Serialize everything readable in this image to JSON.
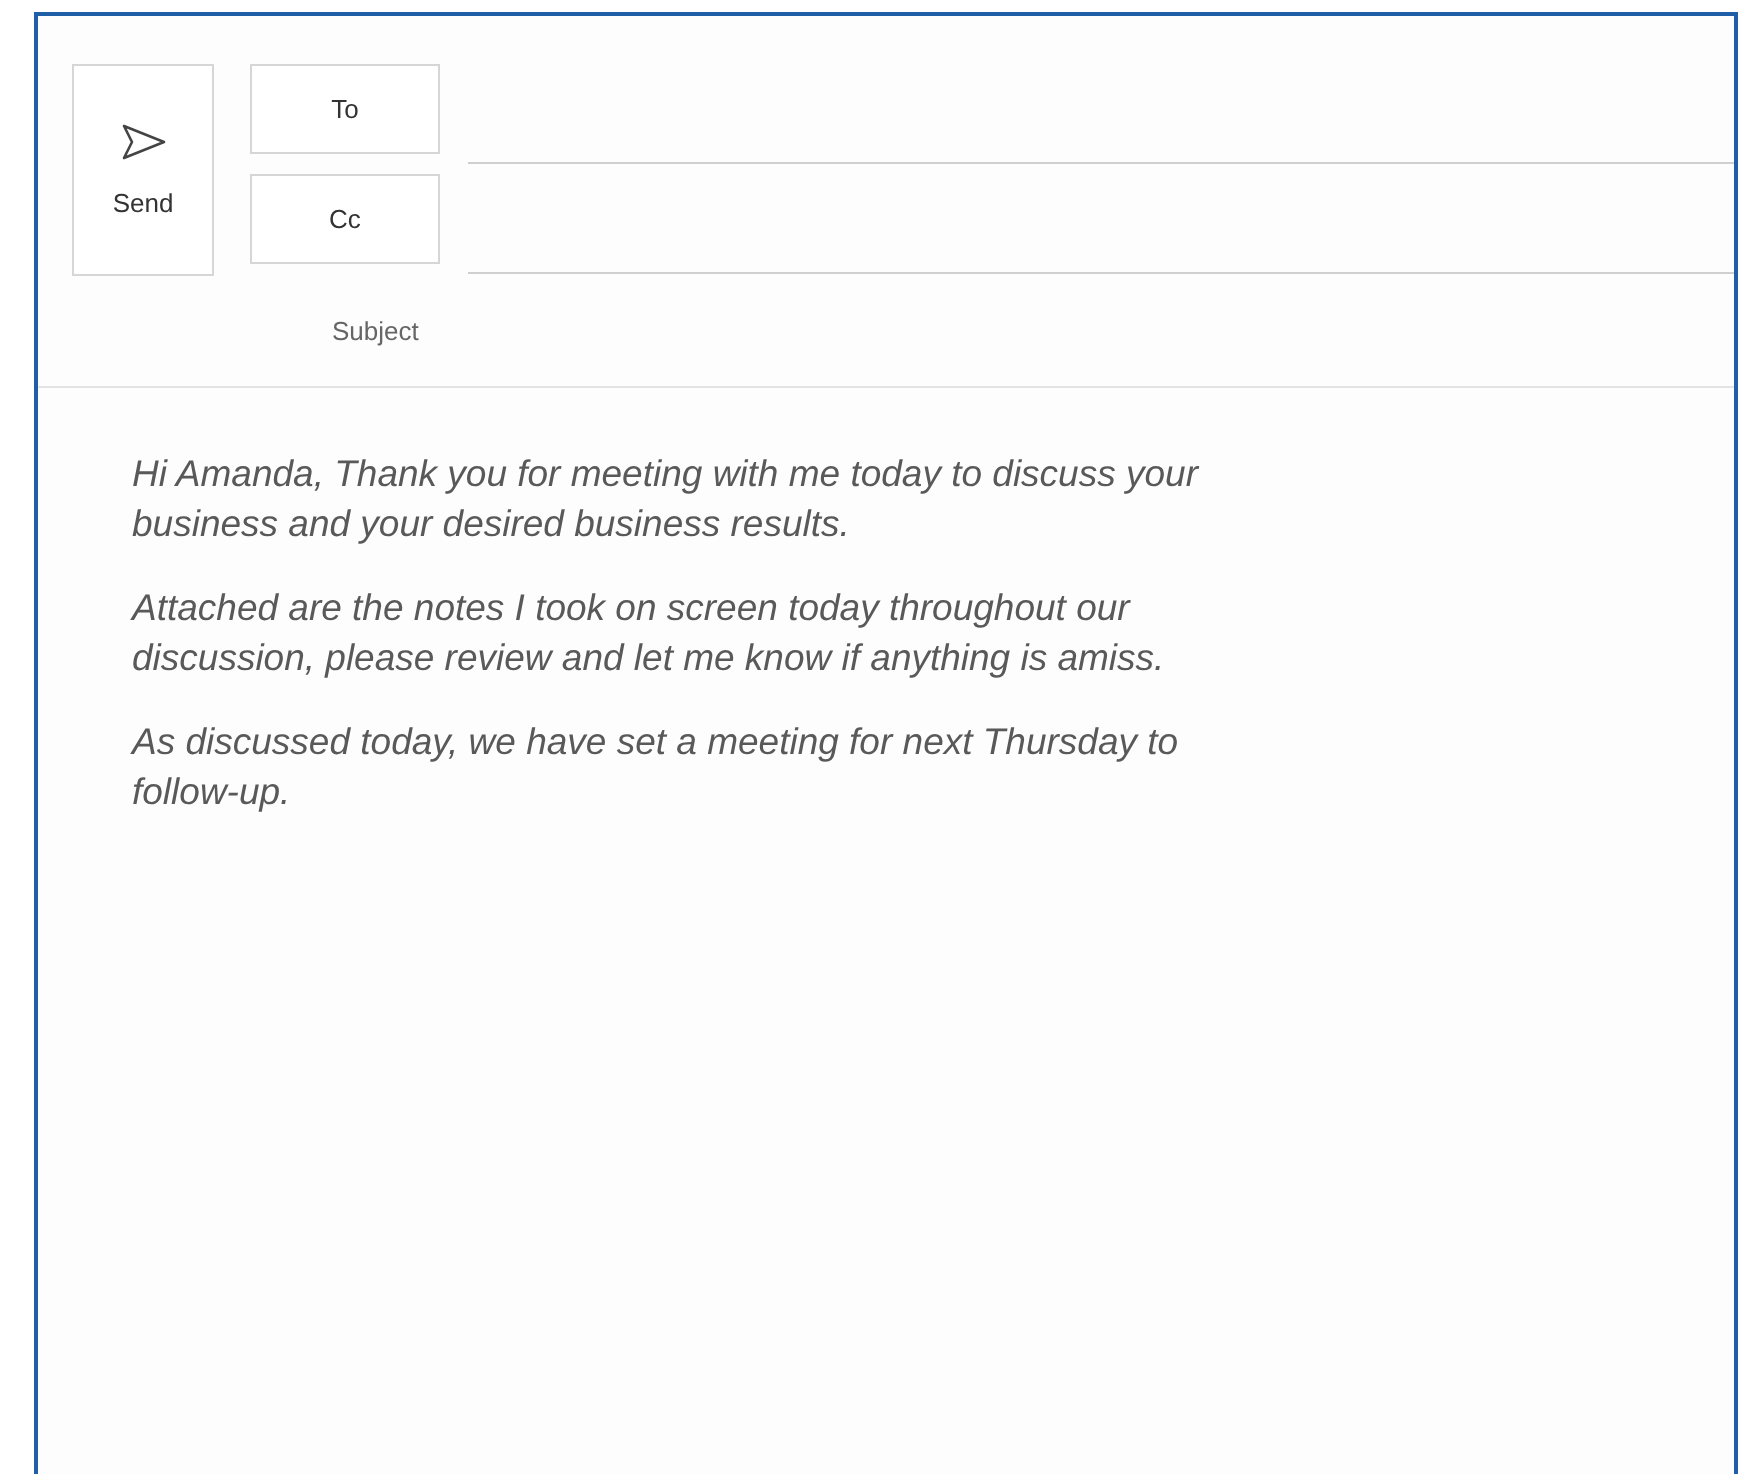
{
  "send_button": {
    "label": "Send"
  },
  "recipients": [
    {
      "label": "To"
    },
    {
      "label": "Cc"
    }
  ],
  "subject": {
    "placeholder": "Subject"
  },
  "body": {
    "paragraphs": [
      "Hi Amanda, Thank you for meeting with me today to discuss your business and your desired business results.",
      "Attached are the notes I took on screen today throughout our discussion, please review and let me know if anything is amiss.",
      "As discussed today, we have set a meeting for next Thursday to follow-up."
    ]
  }
}
